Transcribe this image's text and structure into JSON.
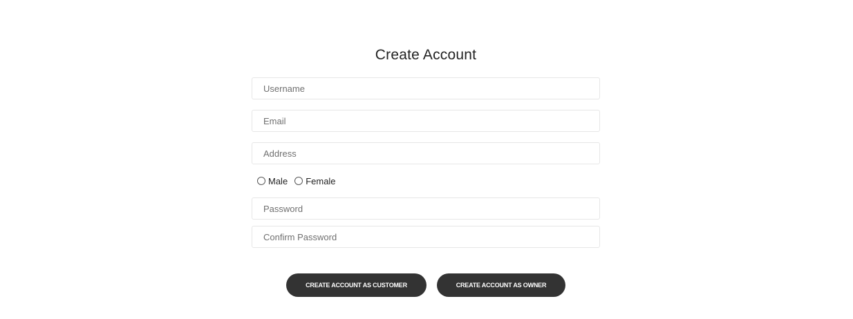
{
  "form": {
    "title": "Create Account",
    "username": {
      "placeholder": "Username",
      "value": ""
    },
    "email": {
      "placeholder": "Email",
      "value": ""
    },
    "address": {
      "placeholder": "Address",
      "value": ""
    },
    "gender": {
      "options": [
        {
          "label": "Male",
          "selected": false
        },
        {
          "label": "Female",
          "selected": false
        }
      ]
    },
    "password": {
      "placeholder": "Password",
      "value": ""
    },
    "confirm_password": {
      "placeholder": "Confirm Password",
      "value": ""
    },
    "buttons": {
      "customer_label": "CREATE ACCOUNT AS CUSTOMER",
      "owner_label": "CREATE ACCOUNT AS OWNER"
    }
  },
  "colors": {
    "background": "#ffffff",
    "button_bg": "#333333",
    "button_text": "#ffffff",
    "field_border": "#e6e6e6"
  }
}
